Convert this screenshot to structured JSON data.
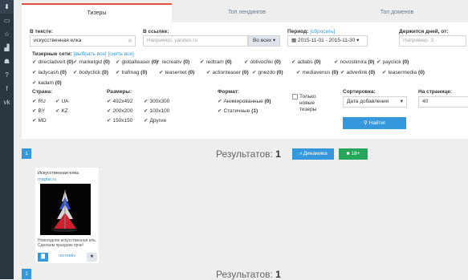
{
  "sidebar": {
    "icons": [
      "download-icon",
      "monitor-icon",
      "star-icon",
      "chart-icon",
      "users-icon",
      "help-icon",
      "facebook-icon",
      "vk-icon"
    ]
  },
  "tabs": [
    {
      "label": "Тизеры",
      "active": true
    },
    {
      "label": "Топ лендингов",
      "active": false
    },
    {
      "label": "Топ доменов",
      "active": false
    }
  ],
  "filters": {
    "text_label": "В тексте:",
    "text_value": "искусственная елка",
    "link_label": "В ссылке:",
    "link_placeholder": "Например, yandex.ru",
    "link_scope": "Во всех",
    "period_label": "Период:",
    "period_reset": "[сбросить]",
    "period_value": "2015-11-01 - 2015-11-30",
    "days_label": "Держится дней, от:",
    "days_placeholder": "Например, 3",
    "networks_label": "Тизерные сети:",
    "networks_select_all": "[выбрать все]",
    "networks_clear_all": "[снять все]",
    "networks": [
      "directadvert",
      "marketgid",
      "globalteaser",
      "recreativ",
      "redtram",
      "oblivochki",
      "adlabs",
      "novostimira",
      "payclick",
      "ladycash",
      "bodyclick",
      "trafmag",
      "teasernet",
      "actionteaser",
      "gnezdo",
      "mediavenus",
      "adverlink",
      "teasermedia",
      "kadam"
    ],
    "network_count": "(0)",
    "country_label": "Страна:",
    "countries": [
      "RU",
      "UA",
      "BY",
      "KZ",
      "MD"
    ],
    "sizes_label": "Размеры:",
    "sizes": [
      "492x492",
      "300x300",
      "200x200",
      "100x100",
      "150x150",
      "Другие"
    ],
    "format_label": "Формат:",
    "formats": [
      {
        "label": "Анимированные",
        "count": "(0)"
      },
      {
        "label": "Статичные",
        "count": "(1)"
      }
    ],
    "only_new_label": "Только новые тизеры",
    "sort_label": "Сортировка:",
    "sort_value": "Дата добавления",
    "per_page_label": "На странице:",
    "per_page_value": "40",
    "find_button": "Найти!"
  },
  "results": {
    "label": "Результатов:",
    "count": "1",
    "page": "1",
    "dynamics_button": "Динамика",
    "adult_button": "18+"
  },
  "card": {
    "title": "Искусственная елка",
    "domain": "magtar.ru",
    "description": "Новогодняя искусственная ель. Сделаем праздник ярче!",
    "network": "recreativ",
    "accent": "#3598dc"
  },
  "colors": {
    "primary": "#3598dc",
    "success": "#26a65b",
    "danger": "#e84c3d",
    "sidebar": "#2b3643"
  }
}
